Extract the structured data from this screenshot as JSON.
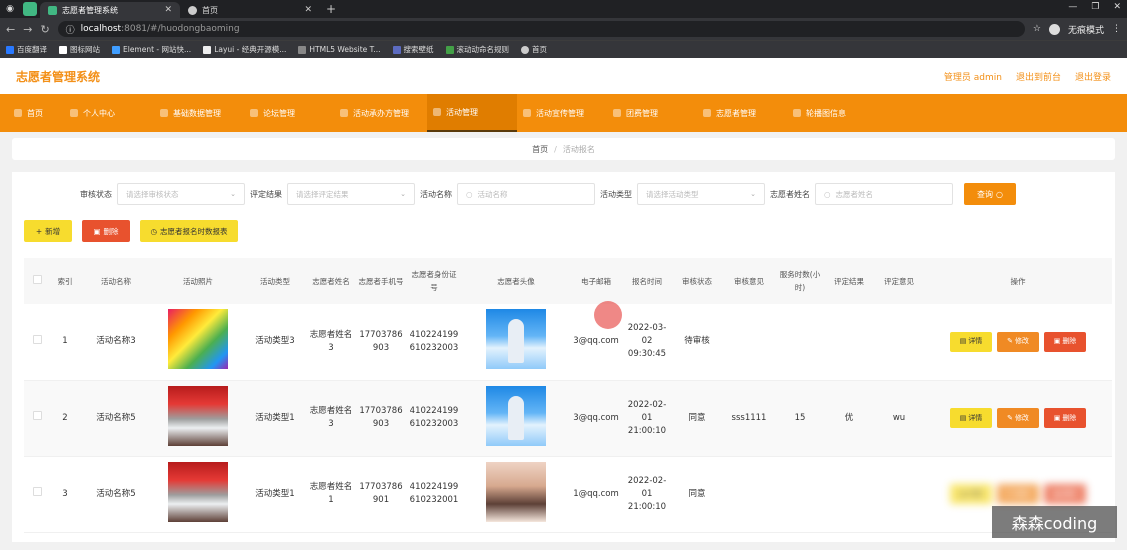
{
  "browser": {
    "tabs": [
      {
        "title": "志愿者管理系统",
        "active": true,
        "favicon_color": "#41b883"
      },
      {
        "title": "首页",
        "active": false,
        "favicon_color": "#cccccc"
      }
    ],
    "url_host": "localhost",
    "url_path": ":8081/#/huodongbaoming",
    "profile_label": "无痕模式",
    "bookmarks": [
      "百度翻译",
      "图标网站",
      "Element - 网站快...",
      "Layui - 经典开源模...",
      "HTML5 Website T...",
      "搜索壁纸",
      "滚动动命名规则",
      "首页"
    ]
  },
  "header": {
    "title": "志愿者管理系统",
    "admin_label": "管理员 admin",
    "back_label": "退出到前台",
    "logout_label": "退出登录"
  },
  "menu": [
    {
      "label": "首页",
      "active": false
    },
    {
      "label": "个人中心",
      "active": false
    },
    {
      "label": "基础数据管理",
      "active": false
    },
    {
      "label": "论坛管理",
      "active": false
    },
    {
      "label": "活动承办方管理",
      "active": false
    },
    {
      "label": "活动管理",
      "active": true
    },
    {
      "label": "活动宣传管理",
      "active": false
    },
    {
      "label": "团费管理",
      "active": false
    },
    {
      "label": "志愿者管理",
      "active": false
    },
    {
      "label": "轮播图信息",
      "active": false
    }
  ],
  "breadcrumb": {
    "home": "首页",
    "separator": "/",
    "current": "活动报名"
  },
  "search": {
    "audit_status_label": "审核状态",
    "audit_status_placeholder": "请选择审核状态",
    "eval_result_label": "评定结果",
    "eval_result_placeholder": "请选择评定结果",
    "activity_name_label": "活动名称",
    "activity_name_placeholder": "活动名称",
    "activity_type_label": "活动类型",
    "activity_type_placeholder": "请选择活动类型",
    "volunteer_name_label": "志愿者姓名",
    "volunteer_name_placeholder": "志愿者姓名",
    "search_button": "查询"
  },
  "actions": {
    "add": "新增",
    "delete": "删除",
    "report": "志愿者报名时数报表"
  },
  "table": {
    "headers": [
      "索引",
      "活动名称",
      "活动照片",
      "活动类型",
      "志愿者姓名",
      "志愿者手机号",
      "志愿者身份证号",
      "志愿者头像",
      "电子邮箱",
      "报名时间",
      "审核状态",
      "审核意见",
      "服务时数(小时)",
      "评定结果",
      "评定意见",
      "操作"
    ],
    "rows": [
      {
        "index": "1",
        "name": "活动名称3",
        "type": "活动类型3",
        "volunteer": "志愿者姓名3",
        "phone": "17703786903",
        "idcard": "410224199610232003",
        "email": "3@qq.com",
        "time": "2022-03-02 09:30:45",
        "status": "待审核",
        "opinion": "",
        "hours": "",
        "result": "",
        "comment": ""
      },
      {
        "index": "2",
        "name": "活动名称5",
        "type": "活动类型1",
        "volunteer": "志愿者姓名3",
        "phone": "17703786903",
        "idcard": "410224199610232003",
        "email": "3@qq.com",
        "time": "2022-02-01 21:00:10",
        "status": "同意",
        "opinion": "sss1111",
        "hours": "15",
        "result": "优",
        "comment": "wu"
      },
      {
        "index": "3",
        "name": "活动名称5",
        "type": "活动类型1",
        "volunteer": "志愿者姓名1",
        "phone": "17703786901",
        "idcard": "410224199610232001",
        "email": "1@qq.com",
        "time": "2022-02-01 21:00:10",
        "status": "同意",
        "opinion": "",
        "hours": "",
        "result": "",
        "comment": ""
      }
    ],
    "op_labels": {
      "detail": "详情",
      "edit": "修改",
      "remove": "删除"
    }
  },
  "watermark": "森森coding",
  "colors": {
    "accent": "#f38d0b",
    "danger": "#e8522e",
    "warning": "#f7dc2e"
  }
}
